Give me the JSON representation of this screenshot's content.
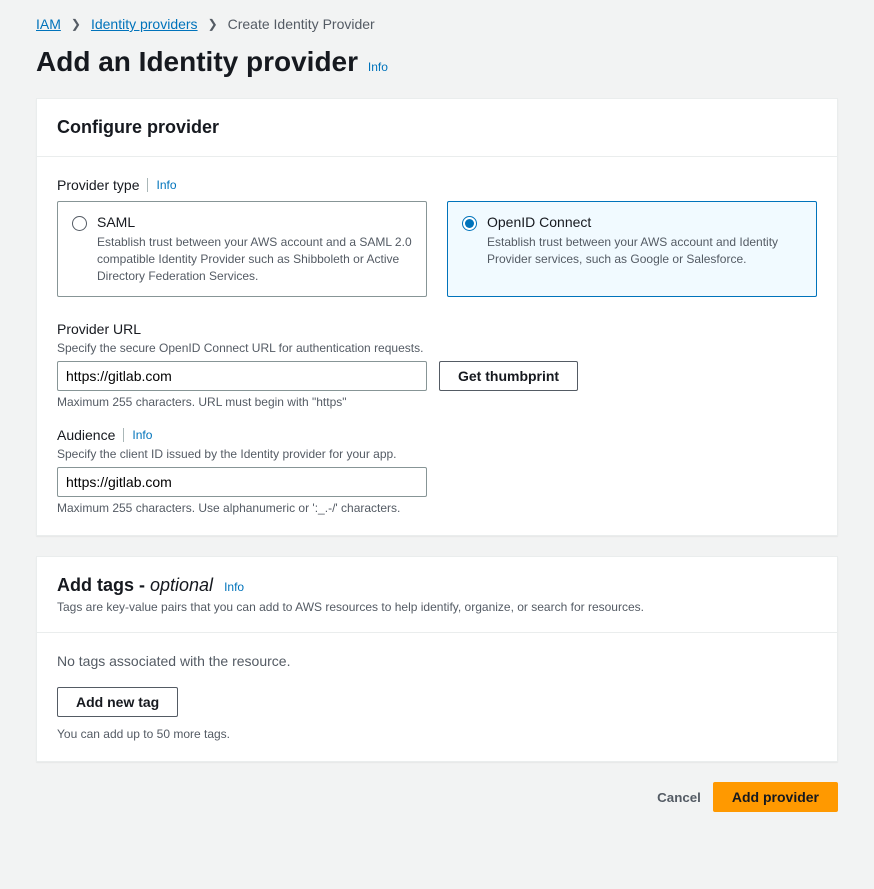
{
  "breadcrumb": {
    "iam": "IAM",
    "providers": "Identity providers",
    "current": "Create Identity Provider"
  },
  "page": {
    "title": "Add an Identity provider",
    "info": "Info"
  },
  "configure": {
    "heading": "Configure provider",
    "providerType": {
      "label": "Provider type",
      "info": "Info",
      "saml": {
        "title": "SAML",
        "desc": "Establish trust between your AWS account and a SAML 2.0 compatible Identity Provider such as Shibboleth or Active Directory Federation Services."
      },
      "oidc": {
        "title": "OpenID Connect",
        "desc": "Establish trust between your AWS account and Identity Provider services, such as Google or Salesforce."
      }
    },
    "providerUrl": {
      "label": "Provider URL",
      "desc": "Specify the secure OpenID Connect URL for authentication requests.",
      "value": "https://gitlab.com",
      "thumbprint": "Get thumbprint",
      "constraint": "Maximum 255 characters. URL must begin with \"https\""
    },
    "audience": {
      "label": "Audience",
      "info": "Info",
      "desc": "Specify the client ID issued by the Identity provider for your app.",
      "value": "https://gitlab.com",
      "constraint": "Maximum 255 characters. Use alphanumeric or ':_.-/' characters."
    }
  },
  "tags": {
    "heading": "Add tags - ",
    "optional": "optional",
    "info": "Info",
    "desc": "Tags are key-value pairs that you can add to AWS resources to help identify, organize, or search for resources.",
    "empty": "No tags associated with the resource.",
    "addButton": "Add new tag",
    "hint": "You can add up to 50 more tags."
  },
  "footer": {
    "cancel": "Cancel",
    "addProvider": "Add provider"
  }
}
